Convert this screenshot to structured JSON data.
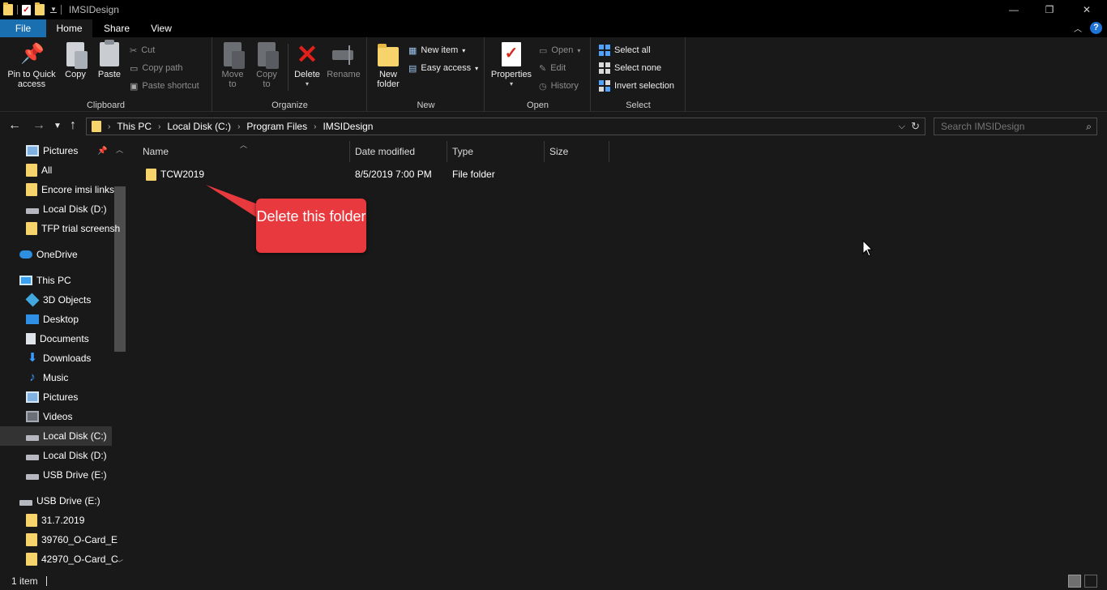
{
  "window": {
    "title": "IMSIDesign",
    "minimize_glyph": "—",
    "restore_glyph": "❐",
    "close_glyph": "✕"
  },
  "tabs": {
    "file": "File",
    "home": "Home",
    "share": "Share",
    "view": "View"
  },
  "ribbon": {
    "clipboard": {
      "label": "Clipboard",
      "pin": "Pin to Quick\naccess",
      "copy": "Copy",
      "paste": "Paste",
      "cut": "Cut",
      "copy_path": "Copy path",
      "paste_shortcut": "Paste shortcut"
    },
    "organize": {
      "label": "Organize",
      "move_to": "Move\nto",
      "copy_to": "Copy\nto",
      "delete": "Delete",
      "rename": "Rename"
    },
    "new": {
      "label": "New",
      "new_folder": "New\nfolder",
      "new_item": "New item",
      "easy_access": "Easy access"
    },
    "open": {
      "label": "Open",
      "properties": "Properties",
      "open": "Open",
      "edit": "Edit",
      "history": "History"
    },
    "select": {
      "label": "Select",
      "select_all": "Select all",
      "select_none": "Select none",
      "invert_selection": "Invert selection"
    }
  },
  "address": {
    "crumbs": [
      "This PC",
      "Local Disk (C:)",
      "Program Files",
      "IMSIDesign"
    ]
  },
  "search": {
    "placeholder": "Search IMSIDesign"
  },
  "nav": {
    "items": [
      {
        "label": "Pictures",
        "icon": "pictures-icon"
      },
      {
        "label": "All",
        "icon": "folder-icon"
      },
      {
        "label": "Encore imsi links",
        "icon": "folder-icon"
      },
      {
        "label": "Local Disk (D:)",
        "icon": "drive-icon"
      },
      {
        "label": "TFP trial screensh",
        "icon": "folder-icon"
      },
      {
        "label": "OneDrive",
        "icon": "onedrive-icon"
      },
      {
        "label": "This PC",
        "icon": "this-pc-icon"
      },
      {
        "label": "3D Objects",
        "icon": "3d-objects-icon"
      },
      {
        "label": "Desktop",
        "icon": "desktop-icon"
      },
      {
        "label": "Documents",
        "icon": "documents-icon"
      },
      {
        "label": "Downloads",
        "icon": "downloads-icon"
      },
      {
        "label": "Music",
        "icon": "music-icon"
      },
      {
        "label": "Pictures",
        "icon": "pictures-icon"
      },
      {
        "label": "Videos",
        "icon": "videos-icon"
      },
      {
        "label": "Local Disk (C:)",
        "icon": "drive-icon"
      },
      {
        "label": "Local Disk (D:)",
        "icon": "drive-icon"
      },
      {
        "label": "USB Drive (E:)",
        "icon": "usb-drive-icon"
      },
      {
        "label": "USB Drive (E:)",
        "icon": "usb-drive-icon"
      },
      {
        "label": "31.7.2019",
        "icon": "folder-icon"
      },
      {
        "label": "39760_O-Card_E",
        "icon": "folder-icon"
      },
      {
        "label": "42970_O-Card_C",
        "icon": "folder-icon"
      }
    ],
    "selected": "Local Disk (C:)"
  },
  "columns": {
    "name": "Name",
    "date_modified": "Date modified",
    "type": "Type",
    "size": "Size"
  },
  "files": [
    {
      "name": "TCW2019",
      "date_modified": "8/5/2019 7:00 PM",
      "type": "File folder",
      "size": ""
    }
  ],
  "callout": {
    "text": "Delete this folder",
    "color": "#e8393e"
  },
  "status": {
    "count": "1 item"
  },
  "colors": {
    "file_tab": "#1a6fb1",
    "background": "#191919",
    "folder": "#f6d36b"
  }
}
